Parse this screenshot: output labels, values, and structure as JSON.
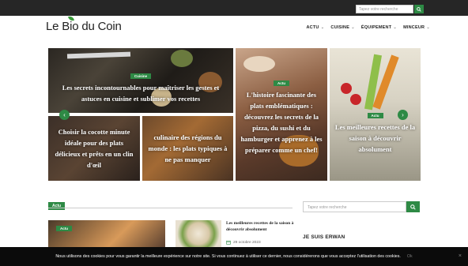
{
  "header": {
    "logo_parts": [
      "Le ",
      "Bio",
      " du Coin"
    ],
    "search_placeholder": "Tapez votre recherche",
    "nav": [
      {
        "label": "ACTU"
      },
      {
        "label": "CUISINE"
      },
      {
        "label": "ÉQUIPEMENT"
      },
      {
        "label": "MINCEUR"
      }
    ]
  },
  "featured": [
    {
      "tag": "Cuisine",
      "title": "Les secrets incontournables pour maîtriser les gestes et astuces en cuisine et sublimer vos recettes"
    },
    {
      "tag": "Actu",
      "title": "L'histoire fascinante des plats emblématiques : découvrez les secrets de la pizza, du sushi et du hamburger et apprenez à les préparer comme un chef!"
    },
    {
      "tag": "Actu",
      "title": "Les meilleures recettes de la saison à découvrir absolument"
    },
    {
      "tag": "",
      "title": "Choisir la cocotte minute idéale pour des plats délicieux et prêts en un clin d'œil"
    },
    {
      "tag": "",
      "title": "culinaire des régions du monde : les plats typiques à ne pas manquer"
    }
  ],
  "section": {
    "badge": "Actu",
    "card_tag": "Actu",
    "post_title": "Les meilleures recettes de la saison à découvrir absolument",
    "post_date": "29 octobre 2023"
  },
  "sidebar": {
    "search_placeholder": "Tapez votre recherche",
    "title": "JE SUIS ERWAN"
  },
  "cookie": {
    "text": "Nous utilisons des cookies pour vous garantir la meilleure expérience sur notre site. Si vous continuez à utiliser ce dernier, nous considérerons que vous acceptez l'utilisation des cookies.",
    "ok": "Ok",
    "close": "×"
  },
  "colors": {
    "accent": "#2e8a45",
    "topbar": "#262626",
    "cookie_bg": "#0b0b0b"
  }
}
